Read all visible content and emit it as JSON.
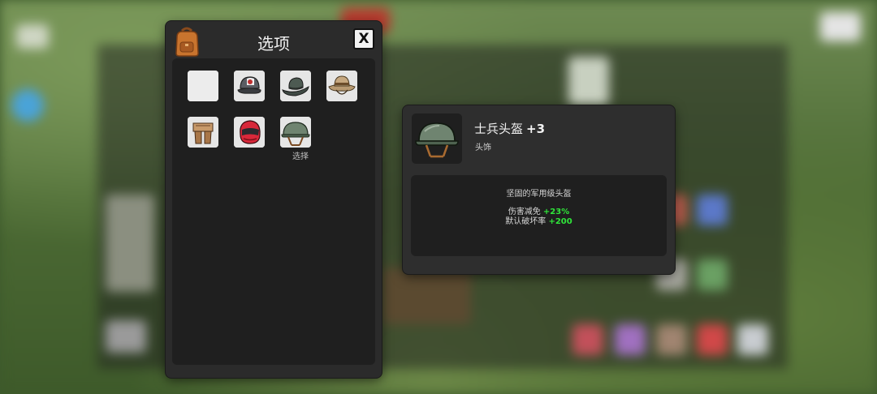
{
  "options_panel": {
    "title": "选项",
    "close_label": "X",
    "select_label": "选择",
    "items": [
      {
        "name": "none",
        "icon": "empty-slot-icon"
      },
      {
        "name": "cap",
        "icon": "baseball-cap-icon"
      },
      {
        "name": "fedora",
        "icon": "fedora-hat-icon"
      },
      {
        "name": "bush hat",
        "icon": "bush-hat-icon"
      },
      {
        "name": "ushanka",
        "icon": "ushanka-hat-icon"
      },
      {
        "name": "motorcycle helmet",
        "icon": "motorcycle-helmet-icon"
      },
      {
        "name": "soldier helmet",
        "icon": "soldier-helmet-icon"
      }
    ]
  },
  "detail_panel": {
    "name": "士兵头盔",
    "level": "+3",
    "type": "头饰",
    "description": "坚固的军用级头盔",
    "stats": [
      {
        "label": "伤害减免",
        "value": "+23%"
      },
      {
        "label": "默认破坏率",
        "value": "+200"
      }
    ]
  },
  "colors": {
    "stat_positive": "#2fe63a",
    "panel_bg": "#2b2b2b",
    "inner_bg": "#1f1f1f"
  }
}
